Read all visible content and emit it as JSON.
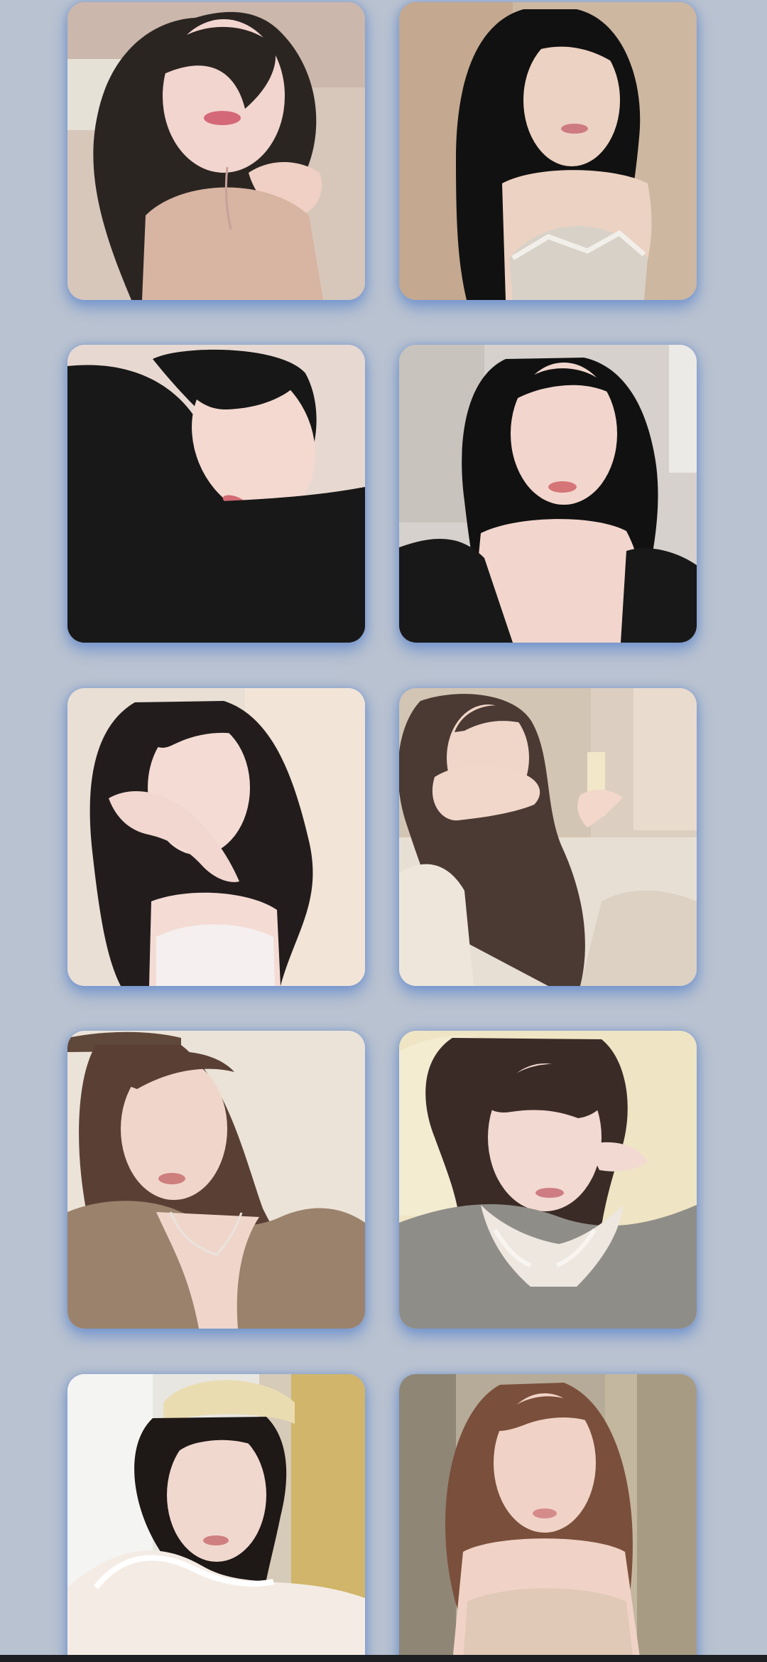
{
  "app": {
    "screen": "photo-gallery"
  },
  "gallery": {
    "columns": 2,
    "items": [
      {
        "image": "portrait-dark-hair-pink-top",
        "palette": {
          "bg": "#d7c7bb",
          "skin": "#f2d5cf",
          "hair": "#2b2522",
          "cloth": "#d8b4a2"
        }
      },
      {
        "image": "portrait-long-black-hair-lace-top",
        "palette": {
          "bg": "#cdb7a1",
          "skin": "#ecd2c2",
          "hair": "#111111",
          "cloth": "#d8d1c7"
        }
      },
      {
        "image": "portrait-lying-black-sweater",
        "palette": {
          "bg": "#e7d9d1",
          "skin": "#f4d9d0",
          "hair": "#171717",
          "cloth": "#181818"
        }
      },
      {
        "image": "portrait-black-hair-black-top",
        "palette": {
          "bg": "#d6d1cc",
          "skin": "#f2d6cd",
          "hair": "#111111",
          "cloth": "#181818"
        }
      },
      {
        "image": "portrait-hand-over-face",
        "palette": {
          "bg": "#eadfd5",
          "skin": "#f4dcd5",
          "hair": "#221d1c",
          "cloth": "#f5f0ef"
        }
      },
      {
        "image": "portrait-covering-mouth-bedroom",
        "palette": {
          "bg": "#d3c5b3",
          "skin": "#f0d6c8",
          "hair": "#4a3a33",
          "cloth": "#e8dfd4"
        }
      },
      {
        "image": "portrait-brown-cardigan-necklace",
        "palette": {
          "bg": "#ece3d8",
          "skin": "#f0d5ca",
          "hair": "#5a4034",
          "cloth": "#9b826c"
        }
      },
      {
        "image": "portrait-bangs-lace-top",
        "palette": {
          "bg": "#efe5c4",
          "skin": "#f2d9d1",
          "hair": "#3a2b27",
          "cloth": "#8f8d87"
        }
      },
      {
        "image": "portrait-headband-fur-coat",
        "palette": {
          "bg": "#e7e6e1",
          "skin": "#f1d8cf",
          "hair": "#1e1816",
          "cloth": "#f4ece4"
        }
      },
      {
        "image": "portrait-auburn-hair-beige-top",
        "palette": {
          "bg": "#b6ab98",
          "skin": "#f0d3c6",
          "hair": "#7a4f3b",
          "cloth": "#e0c9b6"
        }
      }
    ]
  }
}
